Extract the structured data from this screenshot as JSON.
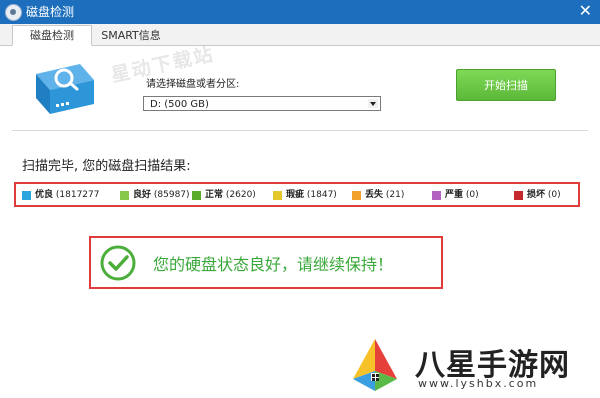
{
  "window": {
    "title": "磁盘检测",
    "close_glyph": "✕"
  },
  "tabs": [
    {
      "label": "磁盘检测",
      "active": true
    },
    {
      "label": "SMART信息",
      "active": false
    }
  ],
  "watermark": "星动下载站",
  "drive": {
    "prompt": "请选择磁盘或者分区:",
    "selected": "D:  (500 GB)"
  },
  "start_button": {
    "label": "开始扫描"
  },
  "result": {
    "heading": "扫描完毕, 您的磁盘扫描结果:"
  },
  "legend": [
    {
      "label": "优良",
      "count": "(1817277",
      "color": "#2aa6de"
    },
    {
      "label": "良好",
      "count": "(85987)",
      "color": "#86c94a"
    },
    {
      "label": "正常",
      "count": "(2620)",
      "color": "#5bab2a"
    },
    {
      "label": "瑕疵",
      "count": "(1847)",
      "color": "#e3c72b"
    },
    {
      "label": "丢失",
      "count": "(21)",
      "color": "#f2a12c"
    },
    {
      "label": "严重",
      "count": "(0)",
      "color": "#b262c0"
    },
    {
      "label": "损坏",
      "count": "(0)",
      "color": "#c4292c"
    }
  ],
  "status": {
    "message": "您的硬盘状态良好，请继续保持！",
    "color": "#3aa83a"
  },
  "site": {
    "name": "八星手游网",
    "url": "www.lyshbx.com"
  },
  "colors": {
    "titlebar": "#1d6fbe",
    "accent_green": "#5cb838",
    "highlight_red": "#e03c3c"
  }
}
